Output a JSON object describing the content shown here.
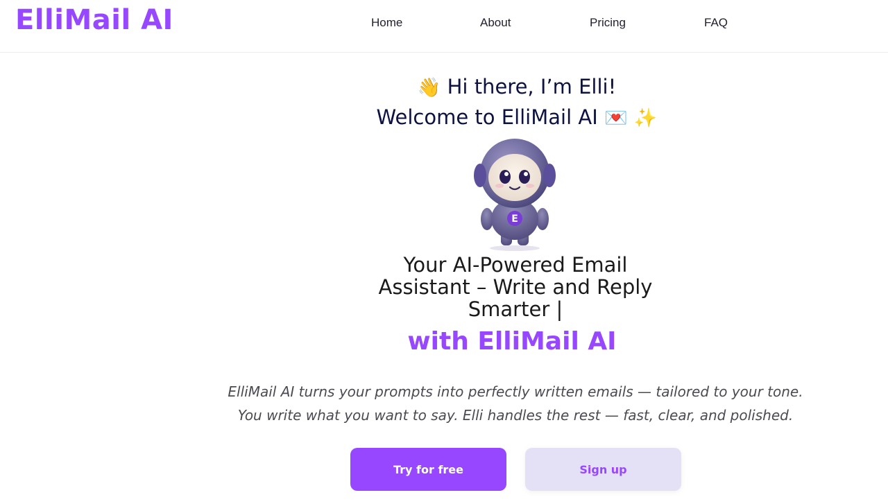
{
  "header": {
    "logo": "ElliMail AI",
    "nav": [
      {
        "label": "Home"
      },
      {
        "label": "About"
      },
      {
        "label": "Pricing"
      },
      {
        "label": "FAQ"
      }
    ]
  },
  "hero": {
    "greeting_line1": "Hi there, I’m Elli!",
    "greeting_line2": "Welcome to ElliMail AI",
    "greeting_emoji1": "👋",
    "greeting_emoji2": "💌",
    "greeting_emoji3": "✨",
    "mascot_label": "E",
    "headline": "Your AI-Powered Email Assistant – Write and Reply Smarter |",
    "headline_accent": "with ElliMail AI",
    "description_line1": "ElliMail AI turns your prompts into perfectly written emails — tailored to your tone.",
    "description_line2": "You write what you want to say. Elli handles the rest — fast, clear, and polished.",
    "primary_button": "Try for free",
    "secondary_button": "Sign up"
  },
  "colors": {
    "accent": "#9747ff",
    "heading": "#0d1240",
    "secondary_button_bg": "#e4e0f5"
  }
}
